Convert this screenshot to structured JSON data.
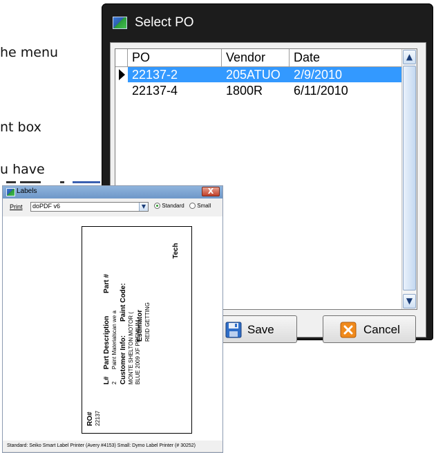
{
  "background_text": [
    "he menu",
    "nt box",
    "u have"
  ],
  "po_dialog": {
    "title": "Select PO",
    "columns": [
      "PO",
      "Vendor",
      "Date"
    ],
    "rows": [
      {
        "po": "22137-2",
        "vendor": "205ATUO",
        "date": "2/9/2010",
        "selected": true
      },
      {
        "po": "22137-4",
        "vendor": "1800R",
        "date": "6/11/2010",
        "selected": false
      }
    ],
    "save_label": "Save",
    "cancel_label": "Cancel",
    "colors": {
      "selection": "#3399ff",
      "titlebar": "#1c1c1c"
    }
  },
  "labels_window": {
    "title": "Labels",
    "close_glyph": "X",
    "print_label": "Print",
    "printer_value": "doPDF v6",
    "radio_standard": "Standard",
    "radio_small": "Small",
    "selected_size": "Standard",
    "card": {
      "ro_header": "RO#",
      "ro_value": "22137",
      "estimator_header": "Estimator",
      "estimator_value": "REID GETTING",
      "tech_header": "Tech",
      "line_header": "L#",
      "line_value": "2",
      "part_desc_header": "Part Description",
      "part_desc_value": "Paint Materialscan we a",
      "part_num_header": "Part #",
      "customer_header": "Customer Info:",
      "customer_line1": "MONTE SHELTON MOTOR (",
      "customer_line2": "BLUE 2009 XF PREMIUM",
      "paint_code_header": "Paint Code:"
    },
    "footer": "Standard: Seiko Smart Label Printer (Avery #4153)  Small: Dymo Label Printer (# 30252)"
  }
}
